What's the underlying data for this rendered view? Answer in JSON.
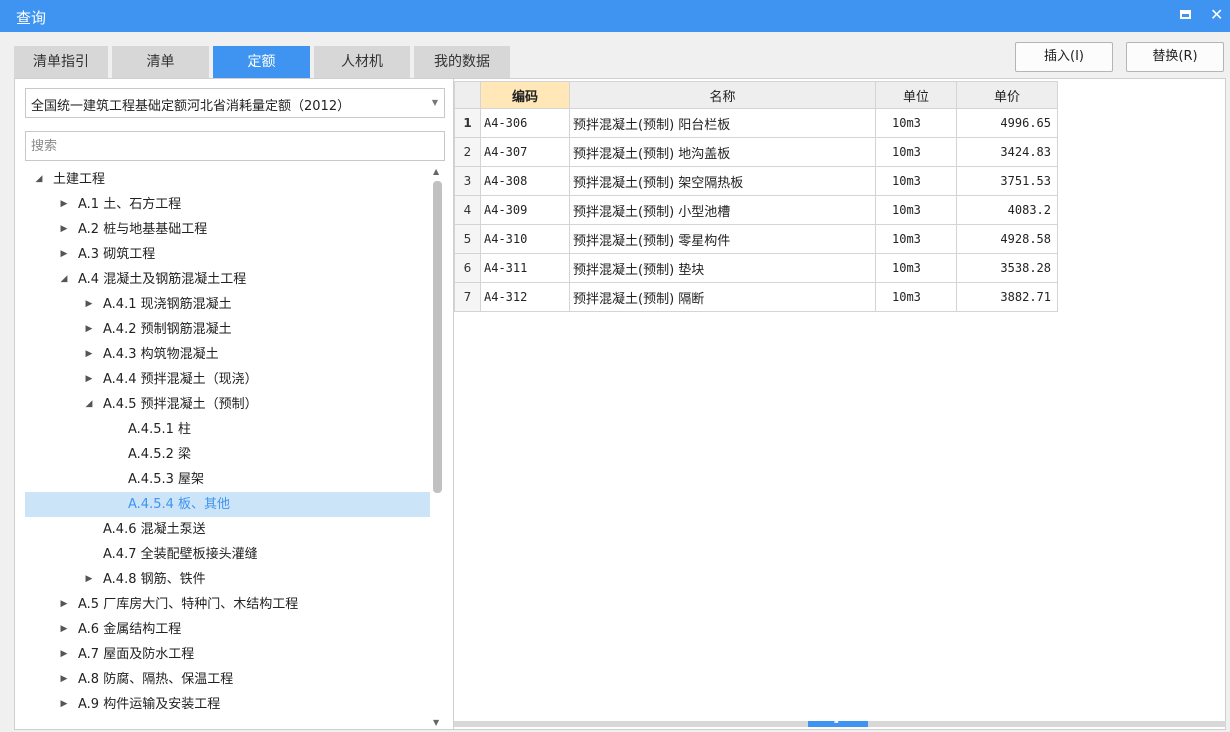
{
  "window": {
    "title": "查询"
  },
  "tabs": [
    {
      "label": "清单指引",
      "active": false
    },
    {
      "label": "清单",
      "active": false
    },
    {
      "label": "定额",
      "active": true
    },
    {
      "label": "人材机",
      "active": false
    },
    {
      "label": "我的数据",
      "active": false
    }
  ],
  "actions": {
    "insert_label": "插入(I)",
    "replace_label": "替换(R)"
  },
  "library_select": {
    "value": "全国统一建筑工程基础定额河北省消耗量定额（2012）"
  },
  "search": {
    "placeholder": "搜索"
  },
  "tree": [
    {
      "label": "土建工程",
      "expander": "expanded"
    },
    {
      "label": "A.1 土、石方工程",
      "expander": "collapsed"
    },
    {
      "label": "A.2 桩与地基基础工程",
      "expander": "collapsed"
    },
    {
      "label": "A.3 砌筑工程",
      "expander": "collapsed"
    },
    {
      "label": "A.4 混凝土及钢筋混凝土工程",
      "expander": "expanded"
    },
    {
      "label": "A.4.1 现浇钢筋混凝土",
      "expander": "collapsed"
    },
    {
      "label": "A.4.2 预制钢筋混凝土",
      "expander": "collapsed"
    },
    {
      "label": "A.4.3 构筑物混凝土",
      "expander": "collapsed"
    },
    {
      "label": "A.4.4 预拌混凝土（现浇）",
      "expander": "collapsed"
    },
    {
      "label": "A.4.5 预拌混凝土（预制）",
      "expander": "expanded"
    },
    {
      "label": "A.4.5.1 柱",
      "expander": "none"
    },
    {
      "label": "A.4.5.2 梁",
      "expander": "none"
    },
    {
      "label": "A.4.5.3 屋架",
      "expander": "none"
    },
    {
      "label": "A.4.5.4 板、其他",
      "expander": "none",
      "selected": true
    },
    {
      "label": "A.4.6 混凝土泵送",
      "expander": "none"
    },
    {
      "label": "A.4.7 全装配壁板接头灌缝",
      "expander": "none"
    },
    {
      "label": "A.4.8 钢筋、铁件",
      "expander": "collapsed"
    },
    {
      "label": "A.5 厂库房大门、特种门、木结构工程",
      "expander": "collapsed"
    },
    {
      "label": "A.6 金属结构工程",
      "expander": "collapsed"
    },
    {
      "label": "A.7 屋面及防水工程",
      "expander": "collapsed"
    },
    {
      "label": "A.8 防腐、隔热、保温工程",
      "expander": "collapsed"
    },
    {
      "label": "A.9 构件运输及安装工程",
      "expander": "collapsed"
    }
  ],
  "grid": {
    "columns": {
      "code": "编码",
      "name": "名称",
      "unit": "单位",
      "price": "单价"
    },
    "rows": [
      {
        "n": "1",
        "code": "A4-306",
        "name": "预拌混凝土(预制) 阳台栏板",
        "unit": "10m3",
        "price": "4996.65"
      },
      {
        "n": "2",
        "code": "A4-307",
        "name": "预拌混凝土(预制) 地沟盖板",
        "unit": "10m3",
        "price": "3424.83"
      },
      {
        "n": "3",
        "code": "A4-308",
        "name": "预拌混凝土(预制) 架空隔热板",
        "unit": "10m3",
        "price": "3751.53"
      },
      {
        "n": "4",
        "code": "A4-309",
        "name": "预拌混凝土(预制) 小型池槽",
        "unit": "10m3",
        "price": "4083.2"
      },
      {
        "n": "5",
        "code": "A4-310",
        "name": "预拌混凝土(预制) 零星构件",
        "unit": "10m3",
        "price": "4928.58"
      },
      {
        "n": "6",
        "code": "A4-311",
        "name": "预拌混凝土(预制) 垫块",
        "unit": "10m3",
        "price": "3538.28"
      },
      {
        "n": "7",
        "code": "A4-312",
        "name": "预拌混凝土(预制) 隔断",
        "unit": "10m3",
        "price": "3882.71"
      }
    ]
  },
  "icons": {
    "maximize": "maximize-icon",
    "close": "close-icon",
    "dropdown": "chevron-down-icon",
    "expanded": "triangle-down-icon",
    "collapsed": "triangle-right-icon"
  },
  "colors": {
    "accent": "#3e94f0",
    "selection_bg": "#cce4f7",
    "sorted_header": "#ffe7b8"
  }
}
